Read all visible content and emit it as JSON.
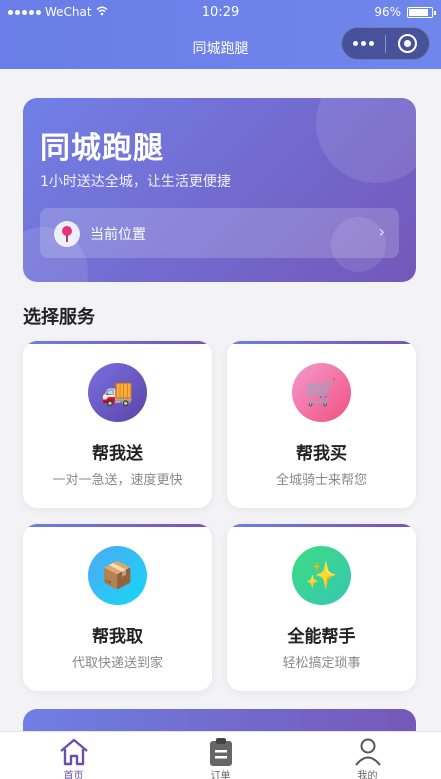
{
  "status_bar": {
    "carrier": "WeChat",
    "time": "10:29",
    "battery": "96%"
  },
  "nav": {
    "title": "同城跑腿"
  },
  "banner": {
    "title": "同城跑腿",
    "subtitle": "1小时送达全城，让生活更便捷",
    "location_label": "当前位置",
    "arrow": "›"
  },
  "section_title": "选择服务",
  "services": [
    {
      "name": "帮我送",
      "desc": "一对一急送，速度更快",
      "icon": "truck-icon",
      "emoji": "🚚",
      "color": "#6a5fc4"
    },
    {
      "name": "帮我买",
      "desc": "全城骑士来帮您",
      "icon": "cart-icon",
      "emoji": "🛒",
      "color": "#f06aa1"
    },
    {
      "name": "帮我取",
      "desc": "代取快递送到家",
      "icon": "package-icon",
      "emoji": "📦",
      "color": "#2bb7f0"
    },
    {
      "name": "全能帮手",
      "desc": "轻松搞定琐事",
      "icon": "sparkles-icon",
      "emoji": "✨",
      "color": "#37d48a"
    }
  ],
  "tabbar": [
    {
      "label": "首页",
      "icon": "home-icon",
      "active": true
    },
    {
      "label": "订单",
      "icon": "clipboard-icon",
      "active": false
    },
    {
      "label": "我的",
      "icon": "user-icon",
      "active": false
    }
  ]
}
